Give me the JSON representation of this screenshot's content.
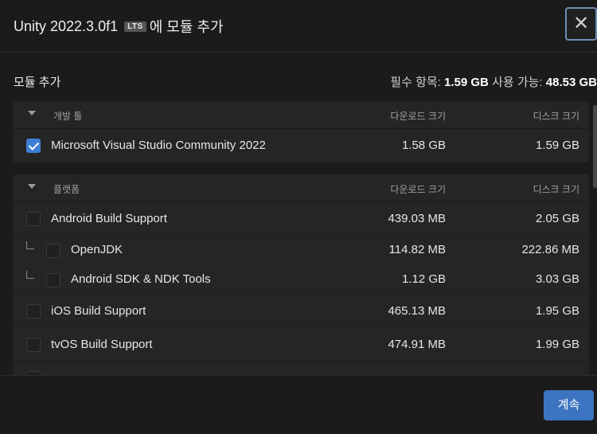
{
  "header": {
    "title_app": "Unity 2022.3.0f1",
    "badge": "LTS",
    "title_suffix": "에 모듈 추가",
    "close_icon": "close-icon"
  },
  "summary": {
    "heading": "모듈 추가",
    "required_label": "필수 항목:",
    "required_value": "1.59 GB",
    "available_label": "사용 가능:",
    "available_value": "48.53 GB"
  },
  "columns": {
    "download": "다운로드 크기",
    "disk": "디스크 크기"
  },
  "sections": [
    {
      "name": "개발 툴",
      "rows": [
        {
          "label": "Microsoft Visual Studio Community 2022",
          "download": "1.58 GB",
          "disk": "1.59 GB",
          "checked": true
        }
      ]
    },
    {
      "name": "플랫폼",
      "rows": [
        {
          "label": "Android Build Support",
          "download": "439.03 MB",
          "disk": "2.05 GB",
          "checked": false
        },
        {
          "label": "OpenJDK",
          "download": "114.82 MB",
          "disk": "222.86 MB",
          "checked": false,
          "child": true
        },
        {
          "label": "Android SDK & NDK Tools",
          "download": "1.12 GB",
          "disk": "3.03 GB",
          "checked": false,
          "child": true
        },
        {
          "label": "iOS Build Support",
          "download": "465.13 MB",
          "disk": "1.95 GB",
          "checked": false
        },
        {
          "label": "tvOS Build Support",
          "download": "474.91 MB",
          "disk": "1.99 GB",
          "checked": false
        }
      ]
    }
  ],
  "footer": {
    "continue_label": "계속"
  },
  "colors": {
    "accent": "#3e7fd6",
    "button": "#3d74c1",
    "background": "#1b1b1b",
    "panel": "#252525"
  }
}
